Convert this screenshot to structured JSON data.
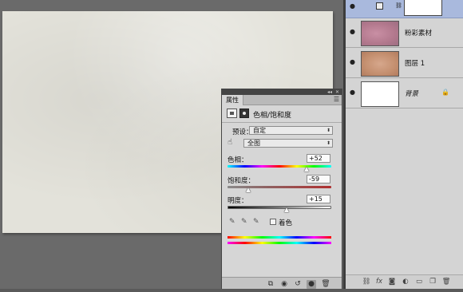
{
  "properties_panel": {
    "tab": "属性",
    "title": "色相/饱和度",
    "preset_label": "预设：",
    "preset_value": "自定",
    "channel_value": "全图",
    "hue": {
      "label": "色相：",
      "value": "+52",
      "position": 0.76
    },
    "saturation": {
      "label": "饱和度：",
      "value": "-59",
      "position": 0.2
    },
    "lightness": {
      "label": "明度：",
      "value": "+15",
      "position": 0.57
    },
    "colorize_label": "着色"
  },
  "layers": [
    {
      "name": "",
      "selected": true,
      "thumb": "adjustment-mask"
    },
    {
      "name": "粉彩素材",
      "thumb_color": "#b2788d"
    },
    {
      "name": "图层 1",
      "thumb_color": "#c48f6f"
    },
    {
      "name": "背景",
      "thumb_color": "#ffffff",
      "locked": true
    }
  ],
  "icons": {
    "eye": "eye-icon",
    "lock": "lock-icon",
    "link": "chain-icon",
    "fx": "fx",
    "trash": "trash-icon"
  }
}
